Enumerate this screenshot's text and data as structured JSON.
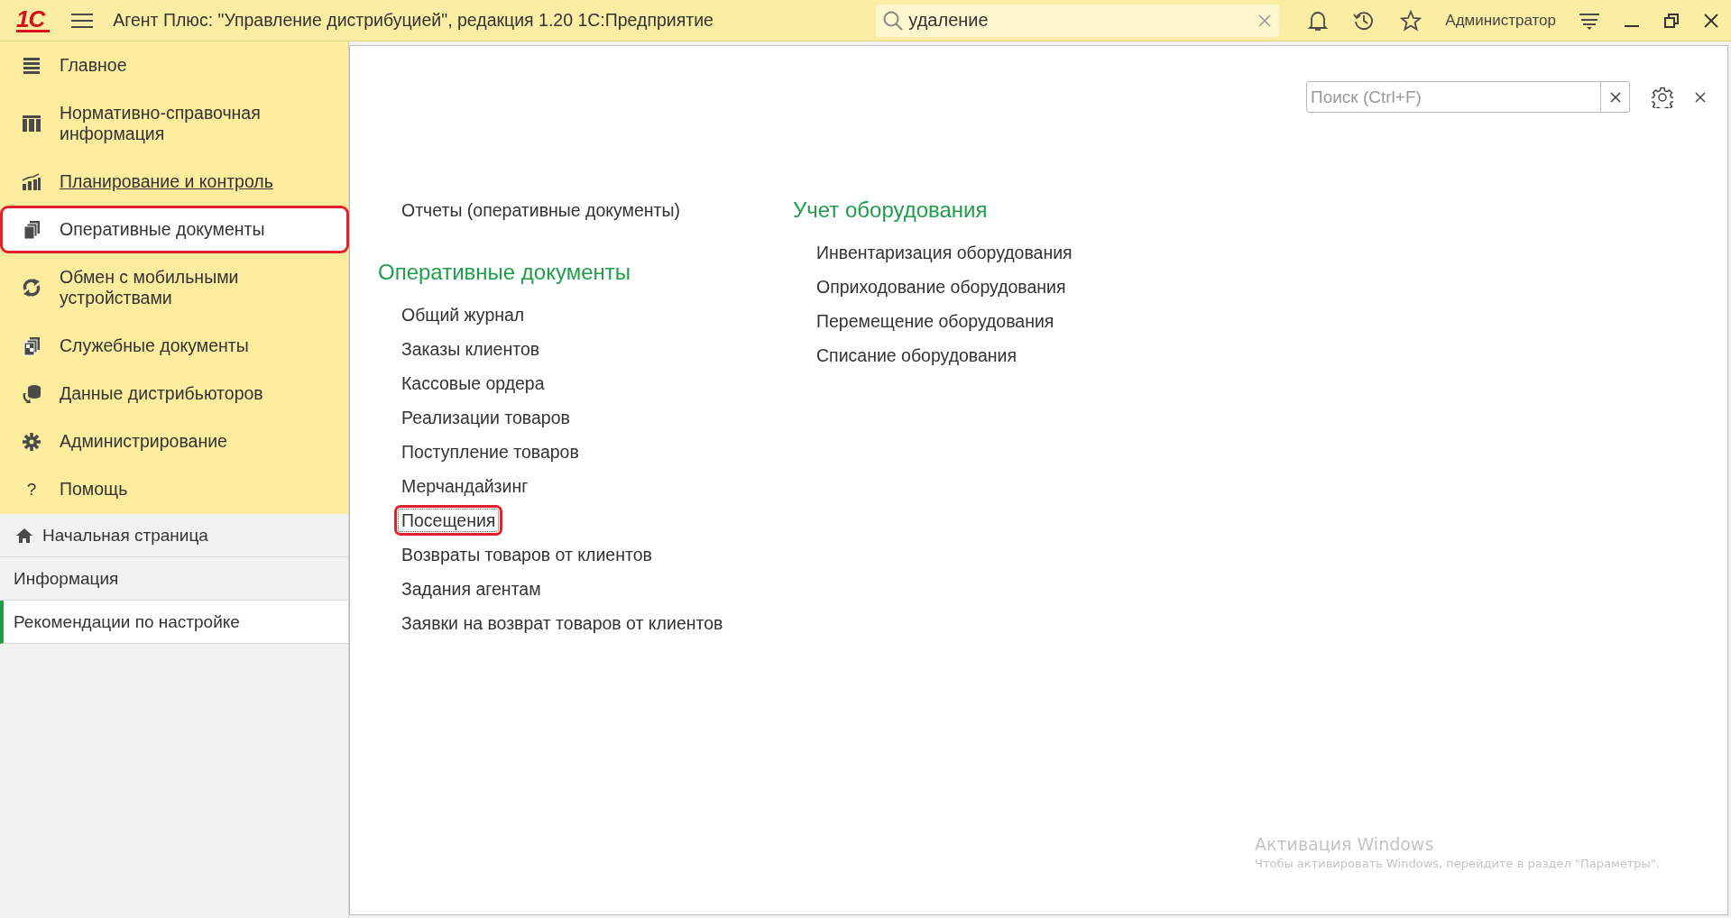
{
  "title_bar": {
    "logo": "1С",
    "title": "Агент Плюс: \"Управление дистрибуцией\", редакция 1.20 1С:Предприятие",
    "search": {
      "value": "удаление"
    },
    "user": "Администратор"
  },
  "sidebar": {
    "sections": [
      {
        "label": "Главное",
        "selected": false,
        "hovered": false,
        "highlighted": false
      },
      {
        "label": "Нормативно-справочная информация",
        "selected": false,
        "hovered": false,
        "highlighted": false
      },
      {
        "label": "Планирование и контроль",
        "selected": false,
        "hovered": true,
        "highlighted": false
      },
      {
        "label": "Оперативные документы",
        "selected": true,
        "hovered": false,
        "highlighted": true
      },
      {
        "label": "Обмен с мобильными устройствами",
        "selected": false,
        "hovered": false,
        "highlighted": false
      },
      {
        "label": "Служебные документы",
        "selected": false,
        "hovered": false,
        "highlighted": false
      },
      {
        "label": "Данные дистрибьюторов",
        "selected": false,
        "hovered": false,
        "highlighted": false
      },
      {
        "label": "Администрирование",
        "selected": false,
        "hovered": false,
        "highlighted": false
      },
      {
        "label": "Помощь",
        "icon_text": "?",
        "selected": false,
        "hovered": false,
        "highlighted": false
      }
    ],
    "pages": [
      {
        "label": "Начальная страница",
        "selected": false
      },
      {
        "label": "Информация",
        "selected": false
      },
      {
        "label": "Рекомендации по настройке",
        "selected": true
      }
    ]
  },
  "content": {
    "search": {
      "placeholder": "Поиск (Ctrl+F)"
    },
    "columns": [
      {
        "groups": [
          {
            "items": [
              {
                "label": "Отчеты (оперативные документы)",
                "highlighted": false,
                "focused": false
              }
            ]
          },
          {
            "heading": "Оперативные документы",
            "items": [
              {
                "label": "Общий журнал",
                "highlighted": false,
                "focused": false
              },
              {
                "label": "Заказы клиентов",
                "highlighted": false,
                "focused": false
              },
              {
                "label": "Кассовые ордера",
                "highlighted": false,
                "focused": false
              },
              {
                "label": "Реализации товаров",
                "highlighted": false,
                "focused": false
              },
              {
                "label": "Поступление товаров",
                "highlighted": false,
                "focused": false
              },
              {
                "label": "Мерчандайзинг",
                "highlighted": false,
                "focused": false
              },
              {
                "label": "Посещения",
                "highlighted": true,
                "focused": true
              },
              {
                "label": "Возвраты товаров от клиентов",
                "highlighted": false,
                "focused": false
              },
              {
                "label": "Задания агентам",
                "highlighted": false,
                "focused": false
              },
              {
                "label": "Заявки на возврат товаров от клиентов",
                "highlighted": false,
                "focused": false
              }
            ]
          }
        ]
      },
      {
        "groups": [
          {
            "heading": "Учет оборудования",
            "items": [
              {
                "label": "Инвентаризация оборудования",
                "highlighted": false,
                "focused": false
              },
              {
                "label": "Оприходование оборудования",
                "highlighted": false,
                "focused": false
              },
              {
                "label": "Перемещение оборудования",
                "highlighted": false,
                "focused": false
              },
              {
                "label": "Списание оборудования",
                "highlighted": false,
                "focused": false
              }
            ]
          }
        ]
      }
    ]
  },
  "os_notice": {
    "title": "Активация Windows",
    "text": "Чтобы активировать Windows, перейдите в раздел \"Параметры\"."
  }
}
